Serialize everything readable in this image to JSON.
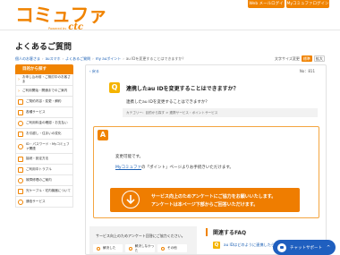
{
  "header": {
    "logo_text": "コミュファ",
    "logo_sub_prefix": "Powered by",
    "logo_sub_brand": "ctc",
    "login_label": "Web メールログイン",
    "my_login_label": "Myコミュファログイン"
  },
  "page": {
    "title": "よくあるご質問"
  },
  "breadcrumb": {
    "items": [
      "個人のお客さま",
      "auスマホ",
      "よくあるご質問",
      "my auポイント"
    ],
    "current": "au IDを変更することはできますか？"
  },
  "font_size": {
    "label": "文字サイズ変更",
    "options": [
      "標準",
      "拡大"
    ]
  },
  "sidebar": {
    "header": "目的から探す",
    "items": [
      {
        "label": "お申し込み前・ご検討中のお客さま",
        "icon": "none"
      },
      {
        "label": "ご利用開始・開通までのご案内",
        "icon": "none"
      },
      {
        "label": "ご契約内容・変更・解約",
        "icon": "document-icon"
      },
      {
        "label": "各種サービス",
        "icon": "grid-icon"
      },
      {
        "label": "ご利用料金の確認・お支払い",
        "icon": "yen-icon"
      },
      {
        "label": "お引越し・住まいの変化",
        "icon": "house-icon"
      },
      {
        "label": "ID・パスワード・Myコミュファ関連",
        "icon": "key-icon"
      },
      {
        "label": "接続・設定方法",
        "icon": "plug-icon"
      },
      {
        "label": "ご利用中トラブル",
        "icon": "warning-icon"
      },
      {
        "label": "故障修理のご案内",
        "icon": "wrench-icon"
      },
      {
        "label": "光ケーブル・宅内機器について",
        "icon": "router-icon"
      },
      {
        "label": "通信サービス",
        "icon": "wifi-icon"
      }
    ]
  },
  "main": {
    "back_label": "戻る",
    "faq_no": "No：811",
    "question_title": "連携したau IDを変更することはできますか？",
    "question_text": "連携したau IDを変更することはできますか？",
    "category": "カテゴリー：目的から探す > 連携サービス・ポイントサービス",
    "answer_line1": "変更可能です。",
    "answer_link": "Myコミュファ",
    "answer_line2_rest": "の「ポイント」ページよりお手続きいただけます。",
    "survey_line1": "サービス向上のためアンケートにご協力をお願いいたします。",
    "survey_line2": "アンケートは本ページ下部からご回答いただけます。",
    "survey_question": "サービス向上のためアンケート回答にご協力ください。",
    "survey_options": [
      "解決した",
      "解決しなかった",
      "その他"
    ],
    "related_title": "関連するFAQ",
    "related_item": "au IDはどのように連携したらいいですか？"
  },
  "chat": {
    "label": "チャットサポート"
  }
}
